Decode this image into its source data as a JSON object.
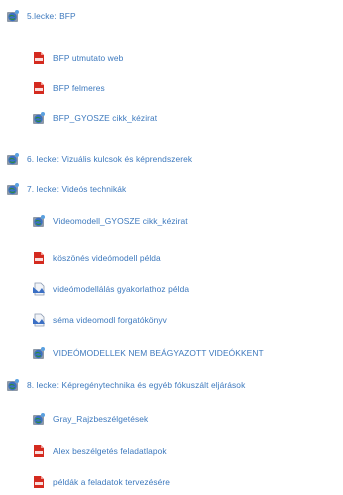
{
  "items": [
    {
      "label": "5.lecke: BFP",
      "icon": "folder-link-icon",
      "level": 0
    },
    {
      "label": "BFP utmutato web",
      "icon": "pdf-file-icon",
      "level": 1
    },
    {
      "label": "BFP felmeres",
      "icon": "pdf-file-icon",
      "level": 1
    },
    {
      "label": "BFP_GYOSZE cikk_kézirat",
      "icon": "folder-link-icon",
      "level": 1
    },
    {
      "label": "6. lecke: Vizuális kulcsok és képrendszerek",
      "icon": "folder-link-icon",
      "level": 0
    },
    {
      "label": "7. lecke: Videós technikák",
      "icon": "folder-link-icon",
      "level": 0
    },
    {
      "label": "Videomodell_GYOSZE cikk_kézirat",
      "icon": "folder-link-icon",
      "level": 1
    },
    {
      "label": "köszönés videómodell példa",
      "icon": "pdf-file-icon",
      "level": 1
    },
    {
      "label": "videómodellálás gyakorlathoz példa",
      "icon": "document-icon",
      "level": 1
    },
    {
      "label": "séma videomodl forgatókönyv",
      "icon": "document-icon",
      "level": 1
    },
    {
      "label": "VIDEÓMODELLEK NEM BEÁGYAZOTT VIDEÓKKENT",
      "icon": "folder-link-icon",
      "level": 1
    },
    {
      "label": "8. lecke: Képregénytechnika és egyéb fókuszált eljárások",
      "icon": "folder-link-icon",
      "level": 0
    },
    {
      "label": "Gray_Rajzbeszélgetések",
      "icon": "folder-link-icon",
      "level": 1
    },
    {
      "label": "Alex beszélgetés feladatlapok",
      "icon": "pdf-file-icon",
      "level": 1
    },
    {
      "label": "példák a feladatok tervezésére",
      "icon": "pdf-file-icon",
      "level": 1
    }
  ],
  "colors": {
    "link": "#3c78bd",
    "pdf_red": "#d42a1f",
    "globe_blue": "#3b6fc4",
    "folder_gray": "#8e9aa8"
  }
}
